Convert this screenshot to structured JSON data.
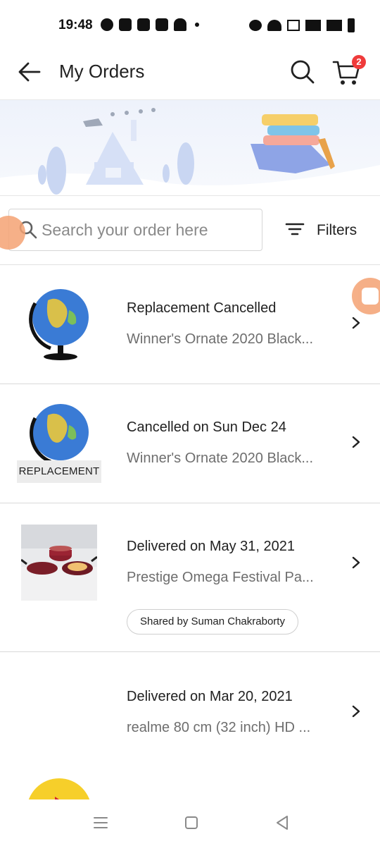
{
  "status_bar": {
    "time": "19:48"
  },
  "app_bar": {
    "title": "My Orders",
    "cart_count": "2"
  },
  "search": {
    "placeholder": "Search your order here",
    "filter_label": "Filters"
  },
  "orders": [
    {
      "status": "Replacement Cancelled",
      "product": "Winner's Ornate 2020 Black...",
      "thumb": "globe-icon"
    },
    {
      "status": "Cancelled on Sun Dec 24",
      "product": "Winner's Ornate 2020 Black...",
      "thumb": "globe-icon",
      "tag": "REPLACEMENT"
    },
    {
      "status": "Delivered on May 31, 2021",
      "product": "Prestige Omega Festival Pa...",
      "thumb": "cookware-image",
      "shared": "Shared by Suman Chakraborty"
    },
    {
      "status": "Delivered on Mar 20, 2021",
      "product": "realme 80 cm (32 inch) HD ..."
    }
  ],
  "colors": {
    "accent": "#ef3b3b",
    "floating_badge": "#f4a273",
    "divider": "#d9d9d9"
  }
}
